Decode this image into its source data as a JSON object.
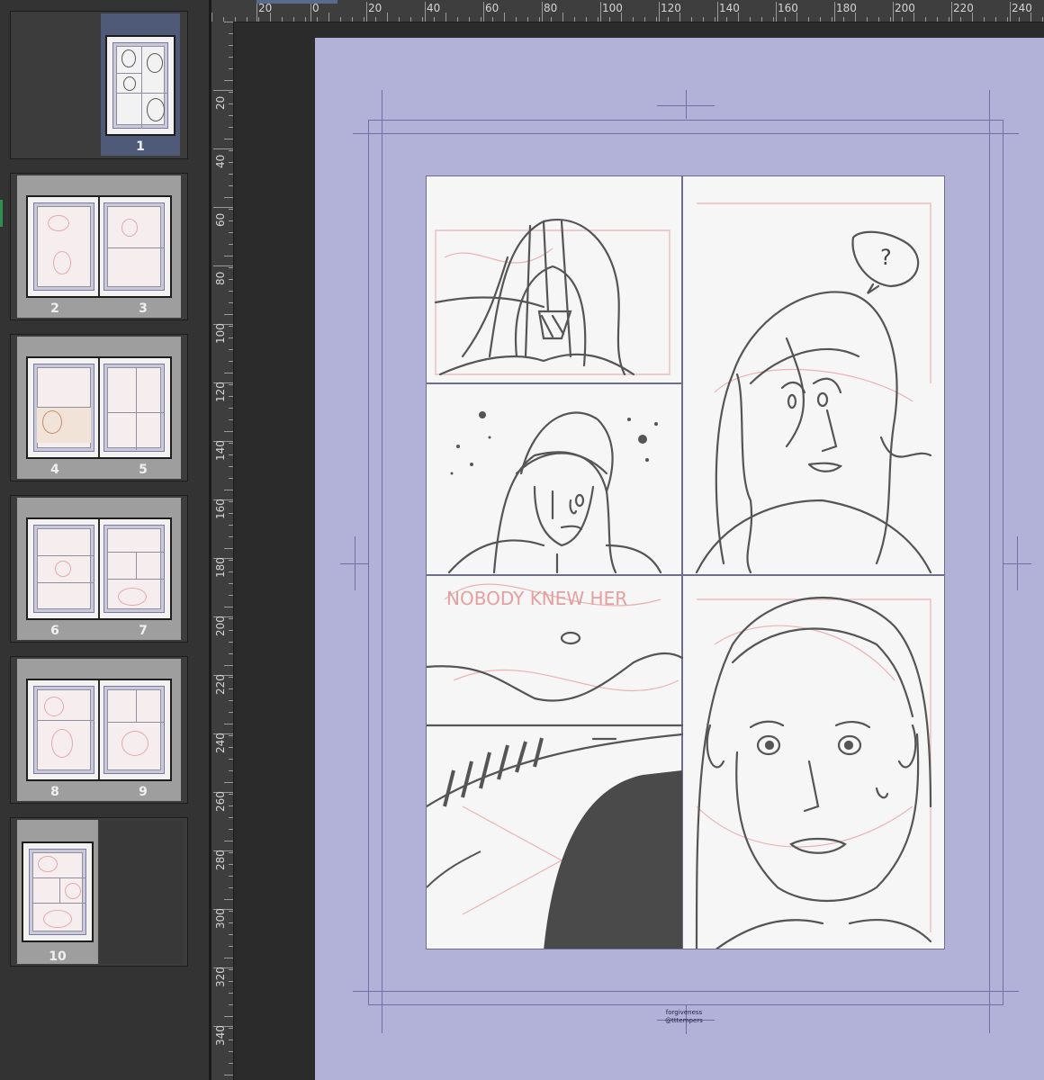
{
  "page_panel": {
    "pages": [
      {
        "id": "p1",
        "numbers": [
          "1"
        ],
        "selected": true
      },
      {
        "id": "p2-3",
        "numbers": [
          "2",
          "3"
        ],
        "selected": false
      },
      {
        "id": "p4-5",
        "numbers": [
          "4",
          "5"
        ],
        "selected": false
      },
      {
        "id": "p6-7",
        "numbers": [
          "6",
          "7"
        ],
        "selected": false
      },
      {
        "id": "p8-9",
        "numbers": [
          "8",
          "9"
        ],
        "selected": false
      },
      {
        "id": "p10",
        "numbers": [
          "10"
        ],
        "selected": false
      }
    ]
  },
  "ruler_top": {
    "labels": [
      "20",
      "0",
      "20",
      "40",
      "60",
      "80",
      "100",
      "120",
      "140",
      "160",
      "180",
      "200",
      "220",
      "240"
    ]
  },
  "ruler_left": {
    "labels": [
      "20",
      "40",
      "60",
      "80",
      "100",
      "120",
      "140",
      "160",
      "180",
      "200",
      "220",
      "240",
      "260",
      "280",
      "300",
      "320",
      "340"
    ]
  },
  "canvas": {
    "credit_line1": "forgiveness",
    "credit_line2": "@tttempers",
    "panel_text": "NOBODY KNEW HER",
    "speech_bubble": "?"
  },
  "colors": {
    "page_bg": "#b2b2d8",
    "guide": "#6f6fa8",
    "selected_thumb": "#4e5a78"
  }
}
